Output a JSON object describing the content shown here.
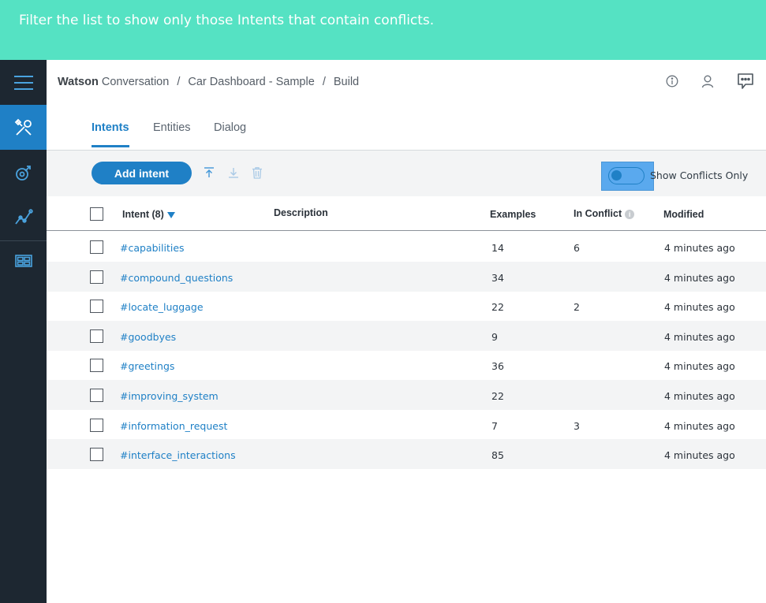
{
  "banner": {
    "instruction": "Filter the list to show only those Intents that contain conflicts."
  },
  "sidebar": {
    "items": [
      {
        "name": "menu",
        "icon": "hamburger-menu-icon"
      },
      {
        "name": "build",
        "icon": "tools-icon",
        "active": true
      },
      {
        "name": "improve",
        "icon": "deploy-icon"
      },
      {
        "name": "analytics",
        "icon": "analytics-icon"
      },
      {
        "name": "workspaces",
        "icon": "workspaces-icon"
      }
    ]
  },
  "breadcrumb": {
    "brand": "Watson",
    "app": "Conversation",
    "workspace": "Car Dashboard - Sample",
    "page": "Build",
    "separator": "/"
  },
  "header_icons": [
    "info-icon",
    "user-icon",
    "chat-icon"
  ],
  "tabs": [
    {
      "label": "Intents",
      "active": true
    },
    {
      "label": "Entities",
      "active": false
    },
    {
      "label": "Dialog",
      "active": false
    }
  ],
  "toolbar": {
    "add_label": "Add intent",
    "toggle_label": "Show Conflicts Only",
    "toggle_on": false
  },
  "table": {
    "headers": {
      "intent": "Intent (8)",
      "description": "Description",
      "examples": "Examples",
      "conflict": "In Conflict",
      "modified": "Modified",
      "info": "i"
    },
    "rows": [
      {
        "intent": "#capabilities",
        "description": "",
        "examples": "14",
        "conflict": "6",
        "modified": "4 minutes ago"
      },
      {
        "intent": "#compound_questions",
        "description": "",
        "examples": "34",
        "conflict": "",
        "modified": "4 minutes ago"
      },
      {
        "intent": "#locate_luggage",
        "description": "",
        "examples": "22",
        "conflict": "2",
        "modified": "4 minutes ago"
      },
      {
        "intent": "#goodbyes",
        "description": "",
        "examples": "9",
        "conflict": "",
        "modified": "4 minutes ago"
      },
      {
        "intent": "#greetings",
        "description": "",
        "examples": "36",
        "conflict": "",
        "modified": "4 minutes ago"
      },
      {
        "intent": "#improving_system",
        "description": "",
        "examples": "22",
        "conflict": "",
        "modified": "4 minutes ago"
      },
      {
        "intent": "#information_request",
        "description": "",
        "examples": "7",
        "conflict": "3",
        "modified": "4 minutes ago"
      },
      {
        "intent": "#interface_interactions",
        "description": "",
        "examples": "85",
        "conflict": "",
        "modified": "4 minutes ago"
      }
    ]
  },
  "colors": {
    "banner": "#55e2c3",
    "sidebar": "#1d2731",
    "accent": "#1f80c6",
    "row_alt": "#f3f4f5"
  }
}
